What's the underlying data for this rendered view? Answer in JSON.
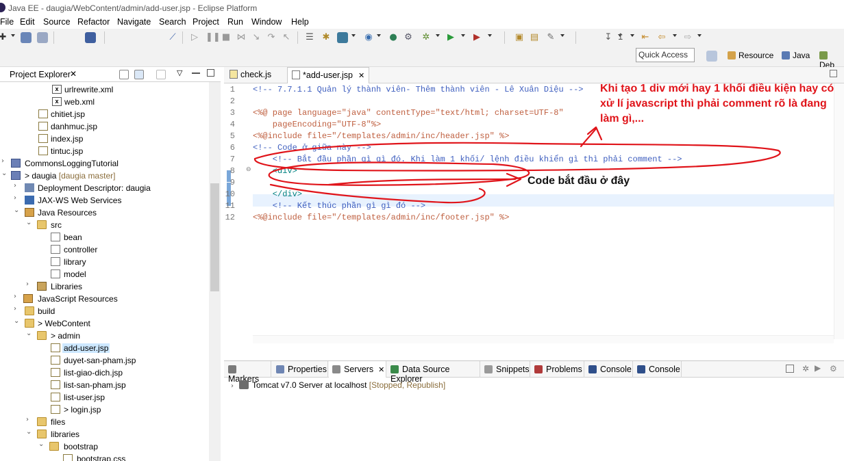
{
  "window": {
    "title": "Java EE - daugia/WebContent/admin/add-user.jsp - Eclipse Platform"
  },
  "menu": [
    "File",
    "Edit",
    "Source",
    "Refactor",
    "Navigate",
    "Search",
    "Project",
    "Run",
    "Window",
    "Help"
  ],
  "toolbar": {
    "quick_access_placeholder": "Quick Access",
    "perspectives": [
      "Resource",
      "Java",
      "Deb"
    ]
  },
  "project_explorer": {
    "title": "Project Explorer",
    "items": [
      {
        "label": "urlrewrite.xml",
        "icon": "xml-file-icon"
      },
      {
        "label": "web.xml",
        "icon": "xml-file-icon"
      },
      {
        "label": "chitiet.jsp",
        "icon": "jsp-file-icon"
      },
      {
        "label": "danhmuc.jsp",
        "icon": "jsp-file-icon"
      },
      {
        "label": "index.jsp",
        "icon": "jsp-file-icon"
      },
      {
        "label": "tintuc.jsp",
        "icon": "jsp-file-icon"
      },
      {
        "label": "CommonsLoggingTutorial",
        "icon": "project-icon"
      },
      {
        "label": "> daugia",
        "decoration": "[daugia master]",
        "icon": "project-icon"
      },
      {
        "label": "Deployment Descriptor: daugia",
        "icon": "deployment-descriptor-icon"
      },
      {
        "label": "JAX-WS Web Services",
        "icon": "web-services-icon"
      },
      {
        "label": "Java Resources",
        "icon": "java-resources-icon"
      },
      {
        "label": "src",
        "icon": "source-folder-icon"
      },
      {
        "label": "bean",
        "icon": "package-icon"
      },
      {
        "label": "controller",
        "icon": "package-icon"
      },
      {
        "label": "library",
        "icon": "package-icon"
      },
      {
        "label": "model",
        "icon": "package-icon"
      },
      {
        "label": "Libraries",
        "icon": "libraries-icon"
      },
      {
        "label": "JavaScript Resources",
        "icon": "javascript-resources-icon"
      },
      {
        "label": "build",
        "icon": "folder-icon"
      },
      {
        "label": "> WebContent",
        "icon": "folder-icon"
      },
      {
        "label": "> admin",
        "icon": "folder-icon"
      },
      {
        "label": "add-user.jsp",
        "icon": "jsp-file-icon"
      },
      {
        "label": "duyet-san-pham.jsp",
        "icon": "jsp-file-icon"
      },
      {
        "label": "list-giao-dich.jsp",
        "icon": "jsp-file-icon"
      },
      {
        "label": "list-san-pham.jsp",
        "icon": "jsp-file-icon"
      },
      {
        "label": "list-user.jsp",
        "icon": "jsp-file-icon"
      },
      {
        "label": "> login.jsp",
        "icon": "jsp-file-icon"
      },
      {
        "label": "files",
        "icon": "folder-icon"
      },
      {
        "label": "libraries",
        "icon": "folder-icon"
      },
      {
        "label": "bootstrap",
        "icon": "folder-icon"
      },
      {
        "label": "bootstrap.css",
        "icon": "css-file-icon"
      }
    ]
  },
  "editor": {
    "tabs": [
      {
        "label": "check.js",
        "active": false
      },
      {
        "label": "*add-user.jsp",
        "active": true
      }
    ],
    "lines": [
      {
        "n": "1",
        "text": "<!-- 7.7.1.1 Quản lý thành viên- Thêm thành viên - Lê Xuân Diệu -->"
      },
      {
        "n": "2",
        "text": ""
      },
      {
        "n": "3",
        "text": "<%@ page language=\"java\" contentType=\"text/html; charset=UTF-8\""
      },
      {
        "n": "4",
        "text": "    pageEncoding=\"UTF-8\"%>"
      },
      {
        "n": "5",
        "text": "<%@include file=\"/templates/admin/inc/header.jsp\" %>"
      },
      {
        "n": "6",
        "text": "<!-- Code ở giữa này -->"
      },
      {
        "n": "7",
        "text": "    <!-- Bắt đầu phần gì gì đó. Khi làm 1 khối/ lệnh điều khiển gì thì phải comment -->"
      },
      {
        "n": "8",
        "text": "    <div>"
      },
      {
        "n": "9",
        "text": ""
      },
      {
        "n": "10",
        "text": "    </div>"
      },
      {
        "n": "11",
        "text": "    <!-- Kết thúc phần gì gì đó -->"
      },
      {
        "n": "12",
        "text": "<%@include file=\"/templates/admin/inc/footer.jsp\" %>"
      }
    ]
  },
  "bottom_panel": {
    "tabs": [
      "Markers",
      "Properties",
      "Servers",
      "Data Source Explorer",
      "Snippets",
      "Problems",
      "Console",
      "Console"
    ],
    "active_tab": "Servers",
    "server": {
      "name": "Tomcat v7.0 Server at localhost",
      "state": "[Stopped, Republish]"
    }
  },
  "annotations": {
    "note_top": "Khi tạo 1 div mới hay 1 khối điều kiện hay có xử lí javascript thì phải comment rõ là đang làm gì,...",
    "note_code": "Code bắt đầu ở đây",
    "color": "#e0141a"
  }
}
